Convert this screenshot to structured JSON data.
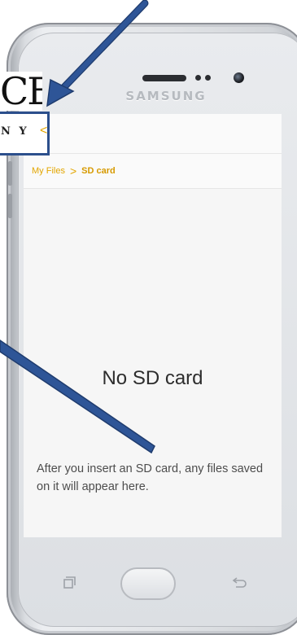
{
  "device": {
    "brand": "SAMSUNG"
  },
  "overlay_logo": {
    "big_text": "CE",
    "sub_text": "N Y",
    "chevron": "<"
  },
  "breadcrumb": {
    "parent": "My Files",
    "separator": ">",
    "current": "SD card"
  },
  "empty_state": {
    "title": "No SD card",
    "message": "After you insert an SD card, any files saved on it will appear here."
  },
  "nav_keys": {
    "recent": "recent-apps-icon",
    "home": "home-button",
    "back": "back-icon"
  },
  "colors": {
    "accent": "#e3a600",
    "arrow": "#2e5597",
    "arrow_stroke": "#1f3c6e"
  }
}
